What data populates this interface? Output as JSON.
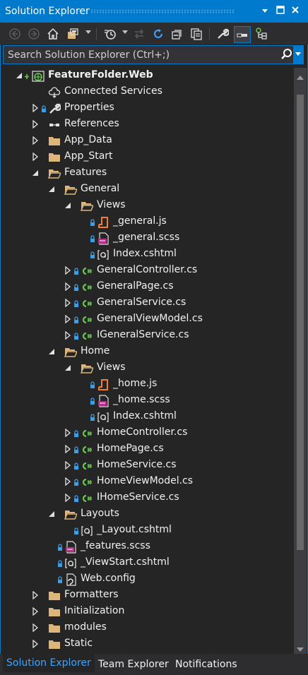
{
  "window": {
    "title": "Solution Explorer",
    "controls": [
      "dropdown-arrow",
      "maximize",
      "close"
    ]
  },
  "toolbar": {
    "buttons": [
      "back",
      "forward",
      "home",
      "switch-views",
      "pending-changes",
      "sync",
      "refresh",
      "collapse-all",
      "show-all-files",
      "properties",
      "preview-selected",
      "view-class-diagram"
    ],
    "pressed": "preview-selected"
  },
  "search": {
    "placeholder": "Search Solution Explorer (Ctrl+;)"
  },
  "tree": [
    {
      "label": "FeatureFolder.Web",
      "level": 0,
      "expander": "expanded",
      "icon": "web-project",
      "bold": true,
      "lock": false,
      "plus": true
    },
    {
      "label": "Connected Services",
      "level": 1,
      "expander": "none",
      "icon": "connected-services",
      "lock": false
    },
    {
      "label": "Properties",
      "level": 1,
      "expander": "collapsed",
      "icon": "wrench",
      "lock": true
    },
    {
      "label": "References",
      "level": 1,
      "expander": "collapsed",
      "icon": "references",
      "lock": false
    },
    {
      "label": "App_Data",
      "level": 1,
      "expander": "collapsed",
      "icon": "folder",
      "lock": false
    },
    {
      "label": "App_Start",
      "level": 1,
      "expander": "collapsed",
      "icon": "folder",
      "lock": false
    },
    {
      "label": "Features",
      "level": 1,
      "expander": "expanded",
      "icon": "folder-open",
      "lock": false
    },
    {
      "label": "General",
      "level": 2,
      "expander": "expanded",
      "icon": "folder-open",
      "lock": false
    },
    {
      "label": "Views",
      "level": 3,
      "expander": "expanded",
      "icon": "folder-open",
      "lock": false
    },
    {
      "label": "_general.js",
      "level": 4,
      "expander": "none",
      "icon": "js-file",
      "lock": true
    },
    {
      "label": "_general.scss",
      "level": 4,
      "expander": "none",
      "icon": "scss-file",
      "lock": true
    },
    {
      "label": "Index.cshtml",
      "level": 4,
      "expander": "none",
      "icon": "razor-file",
      "lock": true
    },
    {
      "label": "GeneralController.cs",
      "level": 3,
      "expander": "collapsed",
      "icon": "csharp-file",
      "lock": true
    },
    {
      "label": "GeneralPage.cs",
      "level": 3,
      "expander": "collapsed",
      "icon": "csharp-file",
      "lock": true
    },
    {
      "label": "GeneralService.cs",
      "level": 3,
      "expander": "collapsed",
      "icon": "csharp-file",
      "lock": true
    },
    {
      "label": "GeneralViewModel.cs",
      "level": 3,
      "expander": "collapsed",
      "icon": "csharp-file",
      "lock": true
    },
    {
      "label": "IGeneralService.cs",
      "level": 3,
      "expander": "collapsed",
      "icon": "csharp-file",
      "lock": true
    },
    {
      "label": "Home",
      "level": 2,
      "expander": "expanded",
      "icon": "folder-open",
      "lock": false
    },
    {
      "label": "Views",
      "level": 3,
      "expander": "expanded",
      "icon": "folder-open",
      "lock": false
    },
    {
      "label": "_home.js",
      "level": 4,
      "expander": "none",
      "icon": "js-file",
      "lock": true
    },
    {
      "label": "_home.scss",
      "level": 4,
      "expander": "none",
      "icon": "scss-file",
      "lock": true
    },
    {
      "label": "Index.cshtml",
      "level": 4,
      "expander": "none",
      "icon": "razor-file",
      "lock": true
    },
    {
      "label": "HomeController.cs",
      "level": 3,
      "expander": "collapsed",
      "icon": "csharp-file",
      "lock": true
    },
    {
      "label": "HomePage.cs",
      "level": 3,
      "expander": "collapsed",
      "icon": "csharp-file",
      "lock": true
    },
    {
      "label": "HomeService.cs",
      "level": 3,
      "expander": "collapsed",
      "icon": "csharp-file",
      "lock": true
    },
    {
      "label": "HomeViewModel.cs",
      "level": 3,
      "expander": "collapsed",
      "icon": "csharp-file",
      "lock": true
    },
    {
      "label": "IHomeService.cs",
      "level": 3,
      "expander": "collapsed",
      "icon": "csharp-file",
      "lock": true
    },
    {
      "label": "Layouts",
      "level": 2,
      "expander": "expanded",
      "icon": "folder-open",
      "lock": false
    },
    {
      "label": "_Layout.cshtml",
      "level": 3,
      "expander": "none",
      "icon": "razor-file",
      "lock": true
    },
    {
      "label": "_features.scss",
      "level": 2,
      "expander": "none",
      "icon": "scss-file",
      "lock": true
    },
    {
      "label": "_ViewStart.cshtml",
      "level": 2,
      "expander": "none",
      "icon": "razor-file",
      "lock": true
    },
    {
      "label": "Web.config",
      "level": 2,
      "expander": "none",
      "icon": "config-file",
      "lock": true
    },
    {
      "label": "Formatters",
      "level": 1,
      "expander": "collapsed",
      "icon": "folder",
      "lock": false
    },
    {
      "label": "Initialization",
      "level": 1,
      "expander": "collapsed",
      "icon": "folder",
      "lock": false
    },
    {
      "label": "modules",
      "level": 1,
      "expander": "collapsed",
      "icon": "folder",
      "lock": false
    },
    {
      "label": "Static",
      "level": 1,
      "expander": "collapsed",
      "icon": "folder",
      "lock": false
    }
  ],
  "tabs": [
    {
      "label": "Solution Explorer",
      "active": true
    },
    {
      "label": "Team Explorer",
      "active": false
    },
    {
      "label": "Notifications",
      "active": false
    }
  ],
  "colors": {
    "accent": "#007acc",
    "background": "#252526",
    "folder": "#dcb67a",
    "csharp": "#68c94f",
    "js": "#f08030",
    "lock": "#3b9fe8"
  }
}
